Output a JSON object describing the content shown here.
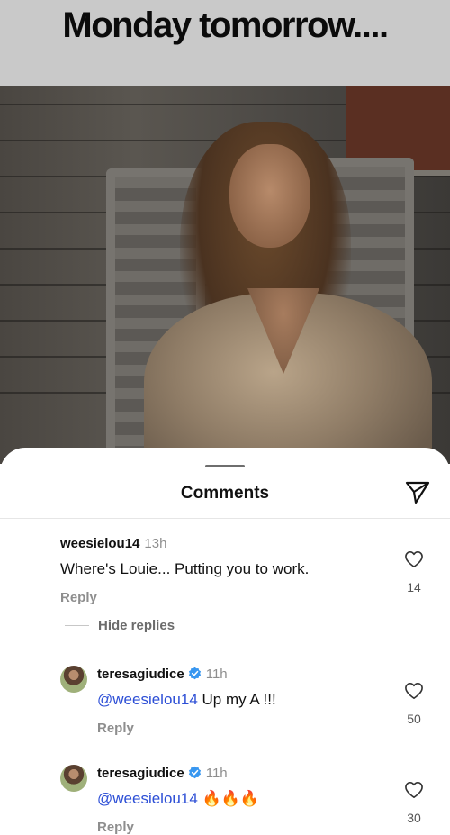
{
  "caption": {
    "text": "Monday tomorrow...."
  },
  "sheet": {
    "title": "Comments",
    "share_icon": "paper-plane-icon"
  },
  "comments": [
    {
      "user": "weesielou14",
      "time": "13h",
      "text": "Where's Louie... Putting you to work.",
      "reply_label": "Reply",
      "likes": "14"
    }
  ],
  "hide_replies_label": "Hide replies",
  "replies": [
    {
      "user": "teresagiudice",
      "verified": true,
      "time": "11h",
      "mention": "@weesielou14",
      "text": " Up my A    !!!",
      "reply_label": "Reply",
      "likes": "50"
    },
    {
      "user": "teresagiudice",
      "verified": true,
      "time": "11h",
      "mention": "@weesielou14",
      "text": " 🔥🔥🔥",
      "reply_label": "Reply",
      "likes": "30"
    }
  ],
  "colors": {
    "mention": "#2d4fd6",
    "verified_badge": "#3897f0",
    "muted": "#8e8e8e"
  }
}
